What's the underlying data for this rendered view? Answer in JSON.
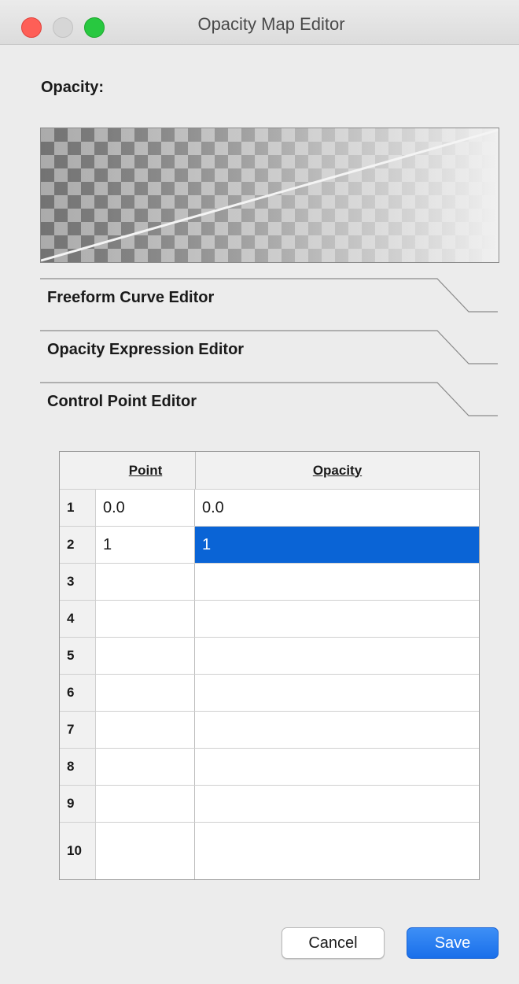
{
  "window": {
    "title": "Opacity Map Editor"
  },
  "opacity_label": "Opacity:",
  "sections": [
    {
      "label": "Freeform Curve Editor"
    },
    {
      "label": "Opacity Expression Editor"
    },
    {
      "label": "Control Point Editor"
    }
  ],
  "table": {
    "headers": {
      "point": "Point",
      "opacity": "Opacity"
    },
    "rows": [
      {
        "index": "1",
        "point": "0.0",
        "opacity": "0.0"
      },
      {
        "index": "2",
        "point": "1",
        "opacity": "1"
      },
      {
        "index": "3",
        "point": "",
        "opacity": ""
      },
      {
        "index": "4",
        "point": "",
        "opacity": ""
      },
      {
        "index": "5",
        "point": "",
        "opacity": ""
      },
      {
        "index": "6",
        "point": "",
        "opacity": ""
      },
      {
        "index": "7",
        "point": "",
        "opacity": ""
      },
      {
        "index": "8",
        "point": "",
        "opacity": ""
      },
      {
        "index": "9",
        "point": "",
        "opacity": ""
      },
      {
        "index": "10",
        "point": "",
        "opacity": ""
      }
    ],
    "selected_cell": "row 2 opacity"
  },
  "buttons": {
    "cancel": "Cancel",
    "save": "Save"
  },
  "colors": {
    "selection": "#0a64d6",
    "save_button": "#1a6fea",
    "close": "#fe5f57",
    "zoom": "#28c840"
  }
}
